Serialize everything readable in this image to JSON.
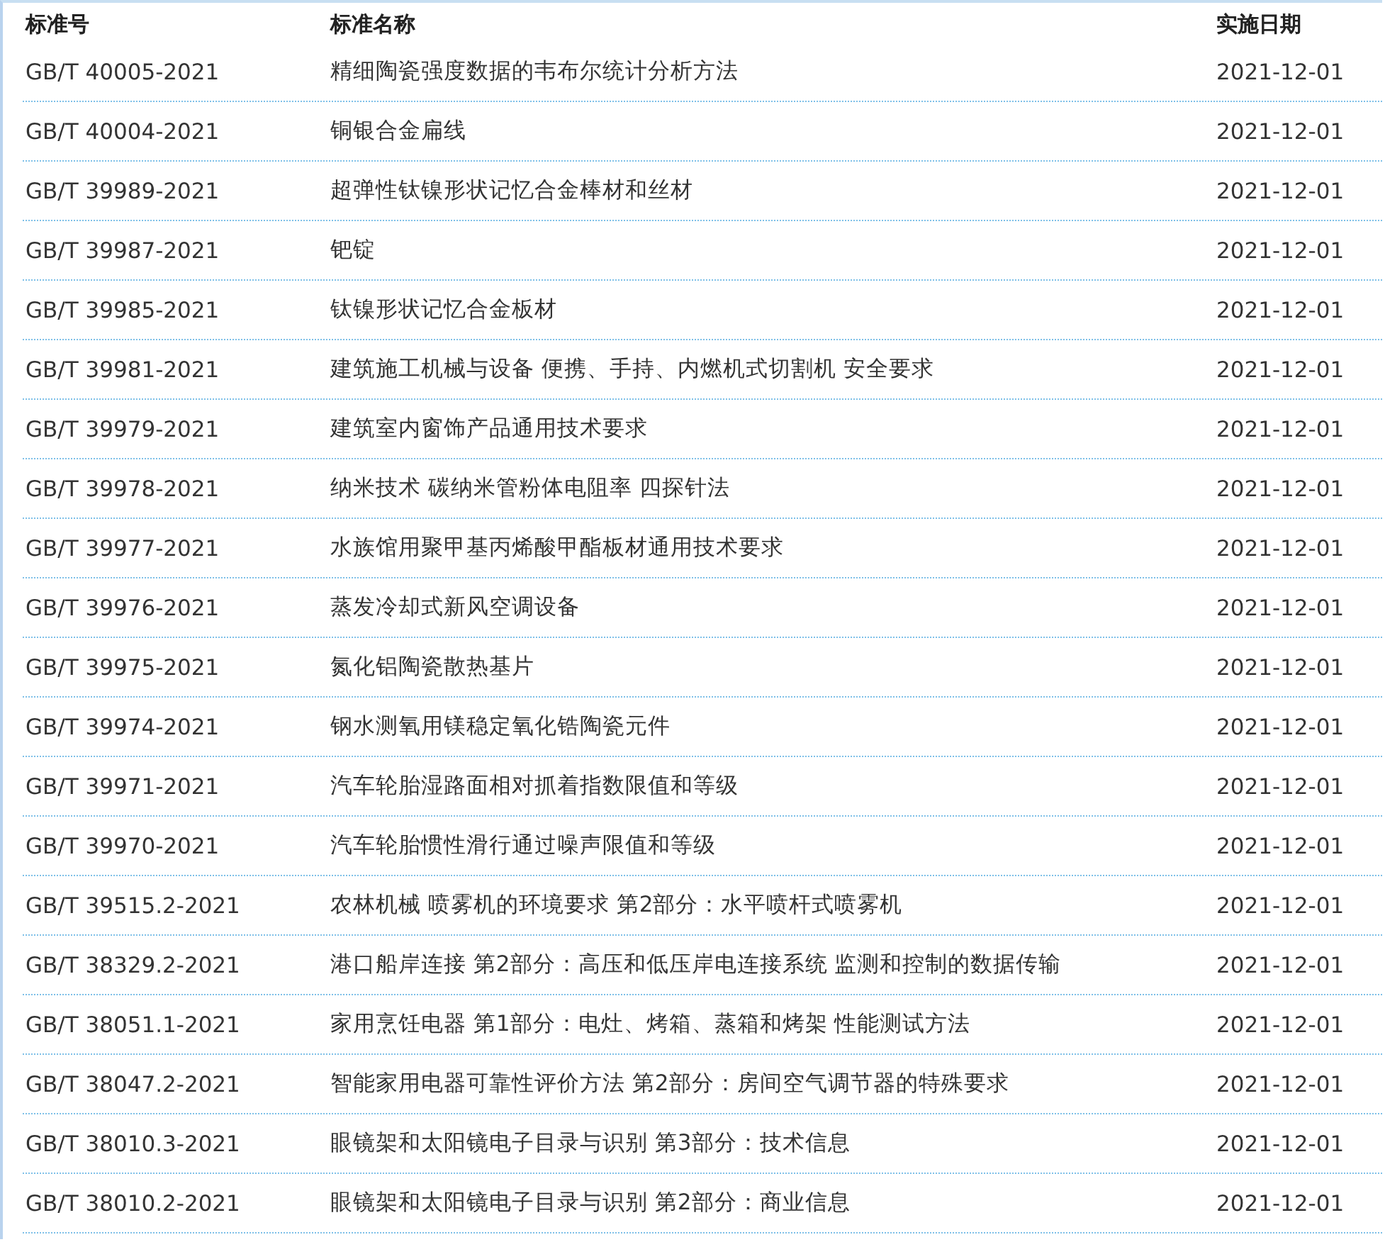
{
  "table": {
    "columns": [
      "标准号",
      "标准名称",
      "实施日期"
    ],
    "rows": [
      [
        "GB/T 40005-2021",
        "精细陶瓷强度数据的韦布尔统计分析方法",
        "2021-12-01"
      ],
      [
        "GB/T 40004-2021",
        "铜银合金扁线",
        "2021-12-01"
      ],
      [
        "GB/T 39989-2021",
        "超弹性钛镍形状记忆合金棒材和丝材",
        "2021-12-01"
      ],
      [
        "GB/T 39987-2021",
        "钯锭",
        "2021-12-01"
      ],
      [
        "GB/T 39985-2021",
        "钛镍形状记忆合金板材",
        "2021-12-01"
      ],
      [
        "GB/T 39981-2021",
        "建筑施工机械与设备 便携、手持、内燃机式切割机 安全要求",
        "2021-12-01"
      ],
      [
        "GB/T 39979-2021",
        "建筑室内窗饰产品通用技术要求",
        "2021-12-01"
      ],
      [
        "GB/T 39978-2021",
        "纳米技术 碳纳米管粉体电阻率 四探针法",
        "2021-12-01"
      ],
      [
        "GB/T 39977-2021",
        "水族馆用聚甲基丙烯酸甲酯板材通用技术要求",
        "2021-12-01"
      ],
      [
        "GB/T 39976-2021",
        "蒸发冷却式新风空调设备",
        "2021-12-01"
      ],
      [
        "GB/T 39975-2021",
        "氮化铝陶瓷散热基片",
        "2021-12-01"
      ],
      [
        "GB/T 39974-2021",
        "钢水测氧用镁稳定氧化锆陶瓷元件",
        "2021-12-01"
      ],
      [
        "GB/T 39971-2021",
        "汽车轮胎湿路面相对抓着指数限值和等级",
        "2021-12-01"
      ],
      [
        "GB/T 39970-2021",
        "汽车轮胎惯性滑行通过噪声限值和等级",
        "2021-12-01"
      ],
      [
        "GB/T 39515.2-2021",
        "农林机械 喷雾机的环境要求 第2部分：水平喷杆式喷雾机",
        "2021-12-01"
      ],
      [
        "GB/T 38329.2-2021",
        "港口船岸连接 第2部分：高压和低压岸电连接系统 监测和控制的数据传输",
        "2021-12-01"
      ],
      [
        "GB/T 38051.1-2021",
        "家用烹饪电器 第1部分：电灶、烤箱、蒸箱和烤架 性能测试方法",
        "2021-12-01"
      ],
      [
        "GB/T 38047.2-2021",
        "智能家用电器可靠性评价方法 第2部分：房间空气调节器的特殊要求",
        "2021-12-01"
      ],
      [
        "GB/T 38010.3-2021",
        "眼镜架和太阳镜电子目录与识别 第3部分：技术信息",
        "2021-12-01"
      ],
      [
        "GB/T 38010.2-2021",
        "眼镜架和太阳镜电子目录与识别 第2部分：商业信息",
        "2021-12-01"
      ]
    ]
  }
}
